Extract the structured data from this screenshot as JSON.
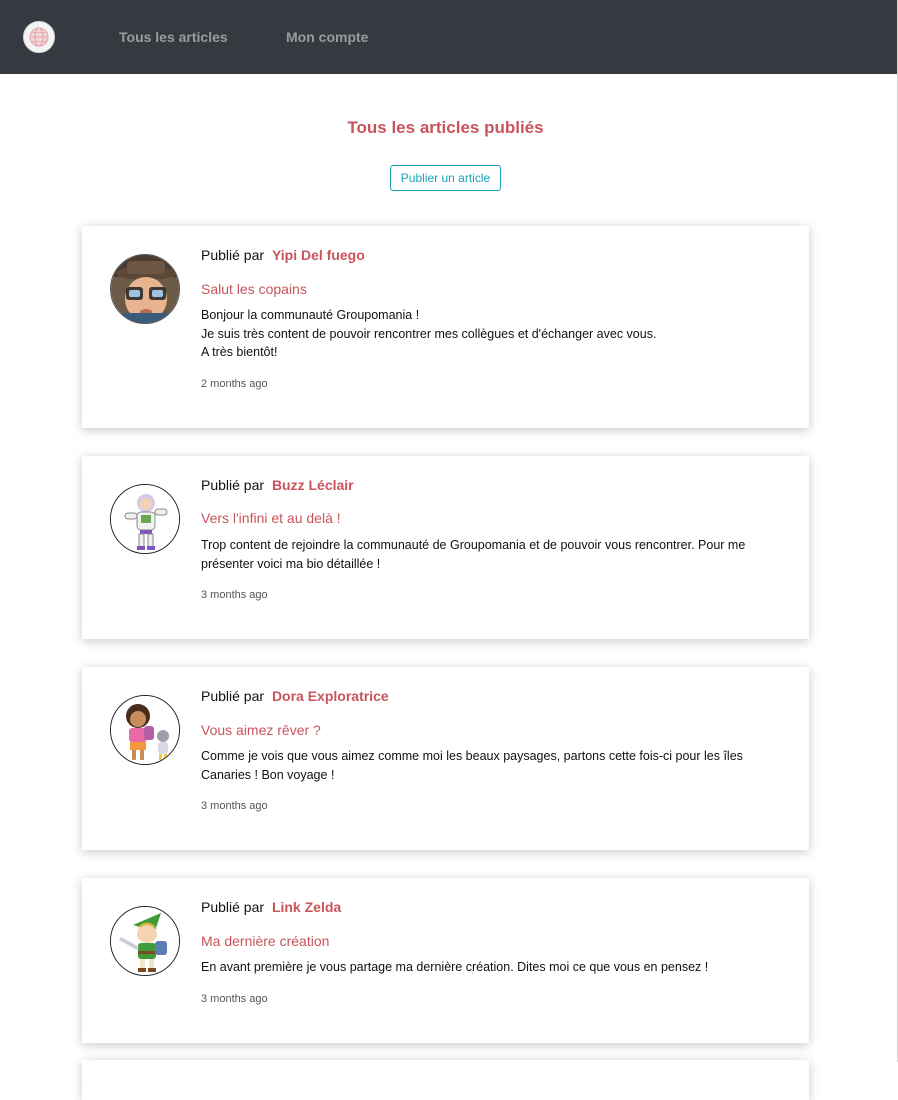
{
  "nav": {
    "logo_icon": "globe-logo-icon",
    "links": [
      "Tous les articles",
      "Mon compte"
    ]
  },
  "main": {
    "title": "Tous les articles publiés",
    "publish_button": "Publier un article"
  },
  "colors": {
    "navbar": "#343a40",
    "accent": "#c9545b",
    "button": "#17a2b8"
  },
  "posts": [
    {
      "prefix": "Publié par",
      "author": "Yipi Del fuego",
      "avatar_icon": "avatar-hat-glasses",
      "title": "Salut les copains",
      "body": [
        "Bonjour la communauté Groupomania !",
        "Je suis très content de pouvoir rencontrer mes collègues et d'échanger avec vous.",
        "A très bientôt!"
      ],
      "time": "2 months ago"
    },
    {
      "prefix": "Publié par",
      "author": "Buzz Léclair",
      "avatar_icon": "avatar-space-ranger",
      "title": "Vers l'infini et au delà !",
      "body": [
        "Trop content de rejoindre la communauté de Groupomania et de pouvoir vous rencontrer. Pour me présenter voici ma bio détaillée !"
      ],
      "time": "3 months ago"
    },
    {
      "prefix": "Publié par",
      "author": "Dora Exploratrice",
      "avatar_icon": "avatar-explorer",
      "title": "Vous aimez rêver ?",
      "body": [
        "Comme je vois que vous aimez comme moi les beaux paysages, partons cette fois-ci pour les îles Canaries ! Bon voyage !"
      ],
      "time": "3 months ago"
    },
    {
      "prefix": "Publié par",
      "author": "Link Zelda",
      "avatar_icon": "avatar-green-elf",
      "title": "Ma dernière création",
      "body": [
        "En avant première je vous partage ma dernière création. Dites moi ce que vous en pensez !"
      ],
      "time": "3 months ago"
    }
  ]
}
